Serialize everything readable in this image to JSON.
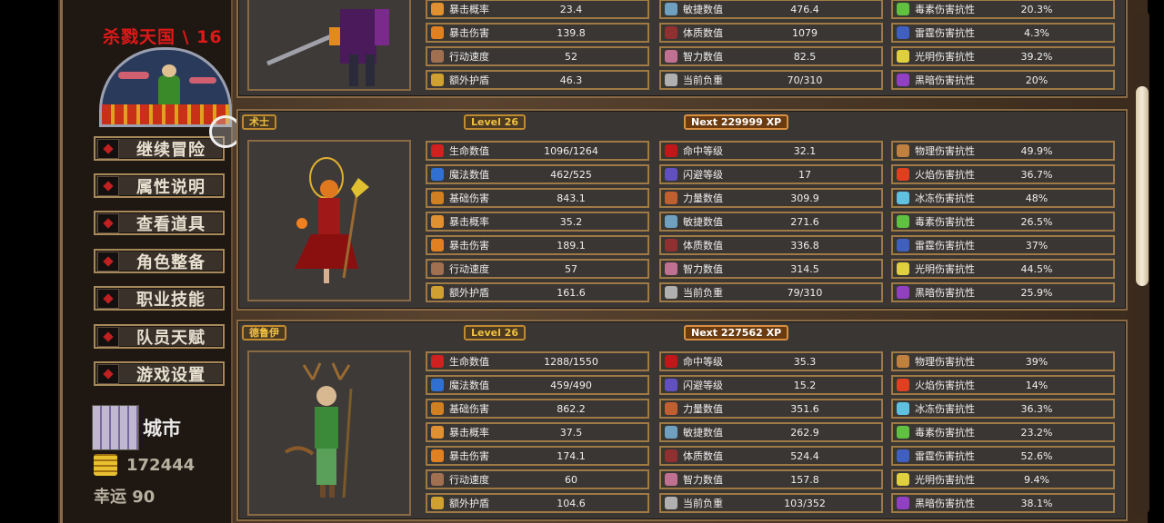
{
  "sidebar": {
    "title": "杀戮天国 \\ 16",
    "menu": [
      "继续冒险",
      "属性说明",
      "查看道具",
      "角色整备",
      "职业技能",
      "队员天赋",
      "游戏设置"
    ],
    "location": "城市",
    "gold": "172444",
    "luck": "幸运 90"
  },
  "characters": [
    {
      "partial": true,
      "rows": [
        [
          "暴击概率",
          "23.4",
          "敏捷数值",
          "476.4",
          "毒素伤害抗性",
          "20.3%"
        ],
        [
          "暴击伤害",
          "139.8",
          "体质数值",
          "1079",
          "雷霆伤害抗性",
          "4.3%"
        ],
        [
          "行动速度",
          "52",
          "智力数值",
          "82.5",
          "光明伤害抗性",
          "39.2%"
        ],
        [
          "额外护盾",
          "46.3",
          "当前负重",
          "70/310",
          "黑暗伤害抗性",
          "20%"
        ]
      ]
    },
    {
      "name": "术士",
      "level": "Level 26",
      "next_xp": "Next 229999 XP",
      "rows": [
        [
          "生命数值",
          "1096/1264",
          "命中等级",
          "32.1",
          "物理伤害抗性",
          "49.9%"
        ],
        [
          "魔法数值",
          "462/525",
          "闪避等级",
          "17",
          "火焰伤害抗性",
          "36.7%"
        ],
        [
          "基础伤害",
          "843.1",
          "力量数值",
          "309.9",
          "冰冻伤害抗性",
          "48%"
        ],
        [
          "暴击概率",
          "35.2",
          "敏捷数值",
          "271.6",
          "毒素伤害抗性",
          "26.5%"
        ],
        [
          "暴击伤害",
          "189.1",
          "体质数值",
          "336.8",
          "雷霆伤害抗性",
          "37%"
        ],
        [
          "行动速度",
          "57",
          "智力数值",
          "314.5",
          "光明伤害抗性",
          "44.5%"
        ],
        [
          "额外护盾",
          "161.6",
          "当前负重",
          "79/310",
          "黑暗伤害抗性",
          "25.9%"
        ]
      ]
    },
    {
      "name": "德鲁伊",
      "level": "Level 26",
      "next_xp": "Next 227562 XP",
      "rows": [
        [
          "生命数值",
          "1288/1550",
          "命中等级",
          "35.3",
          "物理伤害抗性",
          "39%"
        ],
        [
          "魔法数值",
          "459/490",
          "闪避等级",
          "15.2",
          "火焰伤害抗性",
          "14%"
        ],
        [
          "基础伤害",
          "862.2",
          "力量数值",
          "351.6",
          "冰冻伤害抗性",
          "36.3%"
        ],
        [
          "暴击概率",
          "37.5",
          "敏捷数值",
          "262.9",
          "毒素伤害抗性",
          "23.2%"
        ],
        [
          "暴击伤害",
          "174.1",
          "体质数值",
          "524.4",
          "雷霆伤害抗性",
          "52.6%"
        ],
        [
          "行动速度",
          "60",
          "智力数值",
          "157.8",
          "光明伤害抗性",
          "9.4%"
        ],
        [
          "额外护盾",
          "104.6",
          "当前负重",
          "103/352",
          "黑暗伤害抗性",
          "38.1%"
        ]
      ]
    }
  ],
  "icon_colors": {
    "col1": [
      "#d02020",
      "#3070d0",
      "#d08020",
      "#e09030",
      "#e08020",
      "#a07050",
      "#d0a030"
    ],
    "col2": [
      "#c01818",
      "#6050c0",
      "#c06030",
      "#70a0c0",
      "#903030",
      "#c07090",
      "#b0b0b0"
    ],
    "col3": [
      "#c08040",
      "#e04020",
      "#60c0e0",
      "#60c040",
      "#4060c0",
      "#e0d040",
      "#9040c0"
    ]
  }
}
